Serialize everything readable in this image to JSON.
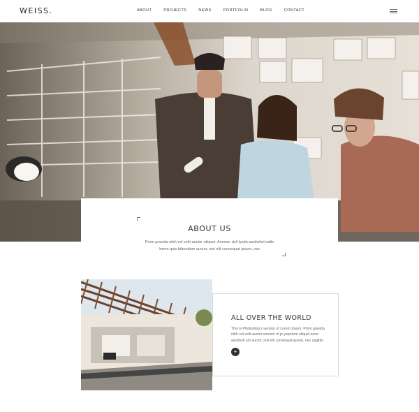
{
  "header": {
    "logo": "WEISS.",
    "nav": [
      "ABOUT",
      "PROJECTS",
      "NEWS",
      "PORTFOLIO",
      "BLOG",
      "CONTACT"
    ],
    "menu_icon": "hamburger-menu-icon"
  },
  "hero": {
    "image": "team-of-architects-reviewing-plans-photo"
  },
  "about": {
    "title": "ABOUT US",
    "text": "Proin gravida nibh vel velit auctor aliquet. Aenean dyli lysda assilcikol tudin lorem quis bibendum auctor, nisi elit consequat ipsum, nec"
  },
  "feature": {
    "image": "modern-house-with-pergola-photo",
    "title": "ALL OVER THE WORLD",
    "text": "This is Photoshop's version of Lorem Ipsum. Proin gravida nibh vel velit auctor version of jo yeporem aliquet aene aendsstl um auctor, nisi elit consequat ipsum, nec sagittis",
    "button_icon": "plus-icon",
    "button_glyph": "+"
  }
}
